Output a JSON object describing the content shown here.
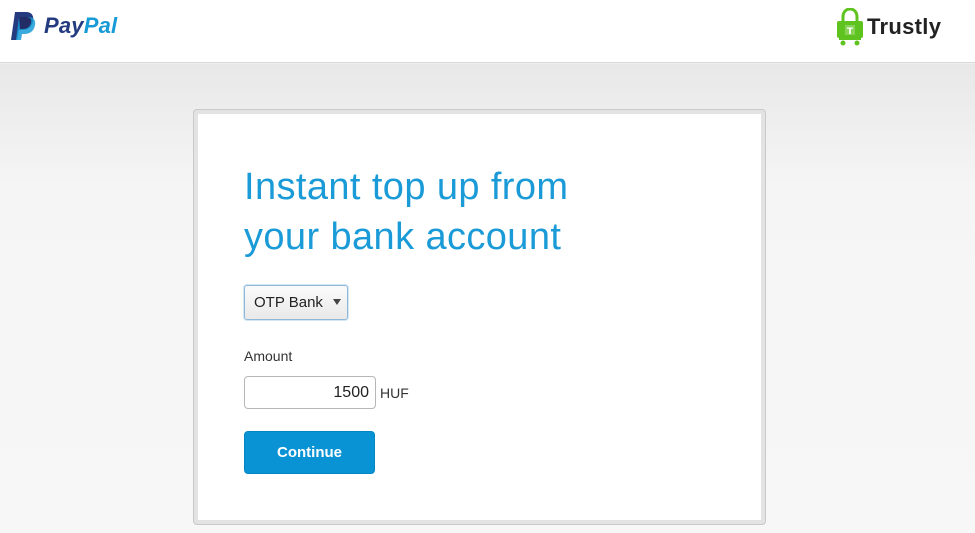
{
  "header": {
    "paypal_logo": {
      "pay": "Pay",
      "pal": "Pal",
      "icon": "paypal-p-icon"
    },
    "trustly_logo": {
      "text": "Trustly",
      "icon": "trustly-lock-icon"
    }
  },
  "card": {
    "title_line1": "Instant top up from",
    "title_line2": "your bank account",
    "bank_select": {
      "selected": "OTP Bank",
      "icon": "chevron-down-icon"
    },
    "amount_label": "Amount",
    "amount_value": "1500",
    "currency": "HUF",
    "continue_label": "Continue"
  },
  "colors": {
    "paypal_dark_blue": "#253b80",
    "paypal_light_blue": "#179bd7",
    "title_blue": "#1a9bd7",
    "button_blue": "#0a93d4",
    "trustly_green": "#5fc31f"
  }
}
